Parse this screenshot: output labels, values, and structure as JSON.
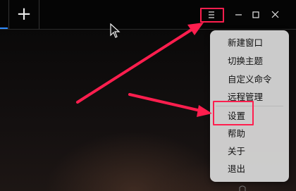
{
  "titlebar": {
    "new_tab_label": "+",
    "menu_icon": "hamburger-menu-icon",
    "minimize_icon": "minimize-icon",
    "maximize_icon": "maximize-icon",
    "close_icon": "close-icon"
  },
  "menu": {
    "items": [
      {
        "label": "新建窗口"
      },
      {
        "label": "切换主题"
      },
      {
        "label": "自定义命令"
      },
      {
        "label": "远程管理"
      },
      {
        "label": "设置"
      },
      {
        "label": "帮助"
      },
      {
        "label": "关于"
      },
      {
        "label": "退出"
      }
    ]
  },
  "annotations": {
    "highlight_color": "#ff1e4e",
    "accent_color": "#2f8cff"
  }
}
